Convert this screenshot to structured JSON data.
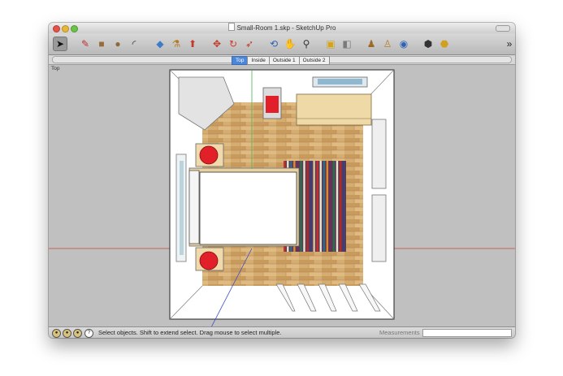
{
  "window": {
    "title": "Small-Room 1.skp - SketchUp Pro"
  },
  "toolbar": {
    "tools": [
      {
        "icon": "select-arrow-icon",
        "glyph": "➤"
      },
      {
        "icon": "pencil-icon",
        "glyph": "✎"
      },
      {
        "icon": "rectangle-icon",
        "glyph": "■"
      },
      {
        "icon": "circle-icon",
        "glyph": "●"
      },
      {
        "icon": "arc-icon",
        "glyph": "◜"
      },
      {
        "icon": "eraser-icon",
        "glyph": "◆"
      },
      {
        "icon": "paint-bucket-icon",
        "glyph": "⚗"
      },
      {
        "icon": "push-pull-icon",
        "glyph": "⬆"
      },
      {
        "icon": "move-icon",
        "glyph": "✥"
      },
      {
        "icon": "rotate-icon",
        "glyph": "↻"
      },
      {
        "icon": "follow-me-icon",
        "glyph": "➶"
      },
      {
        "icon": "orbit-icon",
        "glyph": "⟲"
      },
      {
        "icon": "pan-icon",
        "glyph": "✋"
      },
      {
        "icon": "zoom-icon",
        "glyph": "⚲"
      },
      {
        "icon": "zoom-extents-icon",
        "glyph": "▣"
      },
      {
        "icon": "previous-view-icon",
        "glyph": "◧"
      },
      {
        "icon": "position-camera-icon",
        "glyph": "♟"
      },
      {
        "icon": "walk-icon",
        "glyph": "♙"
      },
      {
        "icon": "look-around-icon",
        "glyph": "◉"
      },
      {
        "icon": "components-icon",
        "glyph": "⬢"
      },
      {
        "icon": "materials-icon",
        "glyph": "⬣"
      }
    ],
    "overflow_label": "»"
  },
  "scenes": {
    "tabs": [
      {
        "label": "Top",
        "active": true
      },
      {
        "label": "Inside",
        "active": false
      },
      {
        "label": "Outside 1",
        "active": false
      },
      {
        "label": "Outside 2",
        "active": false
      }
    ]
  },
  "viewport": {
    "view_label": "Top"
  },
  "status": {
    "message": "Select objects. Shift to extend select. Drag mouse to select multiple.",
    "measurements_label": "Measurements",
    "measurements_value": ""
  },
  "colors": {
    "floor": "#d2ab6e",
    "floor_dark": "#b8894e",
    "wall": "#ffffff",
    "nightstand_lamp": "#e2202a",
    "axis_red": "#c8443a",
    "axis_green": "#4caf50",
    "axis_blue": "#3b4fc4",
    "accent_tab": "#4b86d8"
  }
}
